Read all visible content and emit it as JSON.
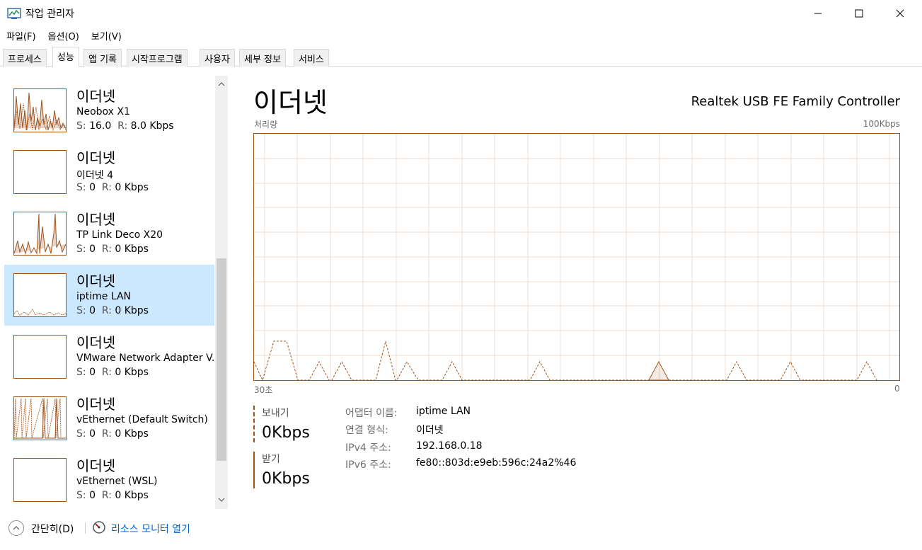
{
  "window": {
    "title": "작업 관리자",
    "icons": {
      "app": "task-manager-icon",
      "minimize": "minimize-icon",
      "maximize": "maximize-icon",
      "close": "close-icon"
    }
  },
  "menu": [
    {
      "label": "파일(F)"
    },
    {
      "label": "옵션(O)"
    },
    {
      "label": "보기(V)"
    }
  ],
  "tabs": [
    {
      "label": "프로세스"
    },
    {
      "label": "성능",
      "active": true
    },
    {
      "label": "앱 기록"
    },
    {
      "label": "시작프로그램"
    },
    {
      "label": "사용자"
    },
    {
      "label": "세부 정보"
    },
    {
      "label": "서비스"
    }
  ],
  "devices": [
    {
      "title": "이더넷",
      "subtitle": "Neobox X1",
      "s_label": "S:",
      "s_value": "16.0",
      "r_label": "R:",
      "r_value": "8.0 Kbps",
      "selected": false
    },
    {
      "title": "이더넷",
      "subtitle": "이더넷 4",
      "s_label": "S:",
      "s_value": "0",
      "r_label": "R:",
      "r_value": "0 Kbps",
      "selected": false
    },
    {
      "title": "이더넷",
      "subtitle": "TP Link Deco X20",
      "s_label": "S:",
      "s_value": "0",
      "r_label": "R:",
      "r_value": "0 Kbps",
      "selected": false
    },
    {
      "title": "이더넷",
      "subtitle": "iptime LAN",
      "s_label": "S:",
      "s_value": "0",
      "r_label": "R:",
      "r_value": "0 Kbps",
      "selected": true
    },
    {
      "title": "이더넷",
      "subtitle": "VMware Network Adapter V...",
      "s_label": "S:",
      "s_value": "0",
      "r_label": "R:",
      "r_value": "0 Kbps",
      "selected": false
    },
    {
      "title": "이더넷",
      "subtitle": "vEthernet (Default Switch)",
      "s_label": "S:",
      "s_value": "0",
      "r_label": "R:",
      "r_value": "0 Kbps",
      "selected": false
    },
    {
      "title": "이더넷",
      "subtitle": "vEthernet (WSL)",
      "s_label": "S:",
      "s_value": "0",
      "r_label": "R:",
      "r_value": "0 Kbps",
      "selected": false
    }
  ],
  "detail": {
    "title": "이더넷",
    "adapter_full_name": "Realtek USB FE Family Controller",
    "throughput_label": "처리량",
    "max_label": "100Kbps",
    "x_left_label": "30초",
    "x_right_label": "0",
    "send_label": "보내기",
    "send_value": "0Kbps",
    "recv_label": "받기",
    "recv_value": "0Kbps",
    "info": [
      {
        "key": "어댑터 이름:",
        "value": "iptime LAN"
      },
      {
        "key": "연결 형식:",
        "value": "이더넷"
      },
      {
        "key": "IPv4 주소:",
        "value": "192.168.0.18"
      },
      {
        "key": "IPv6 주소:",
        "value": "fe80::803d:e9eb:596c:24a2%46"
      }
    ],
    "colors": {
      "accent": "#a0521b",
      "grid": "#f0dcd0",
      "selected": "#cce8ff"
    }
  },
  "footer": {
    "collapse_label": "간단히(D)",
    "resource_monitor_label": "리소스 모니터 열기",
    "icons": {
      "collapse": "chevron-up-icon",
      "resource_monitor": "resource-monitor-icon"
    }
  }
}
